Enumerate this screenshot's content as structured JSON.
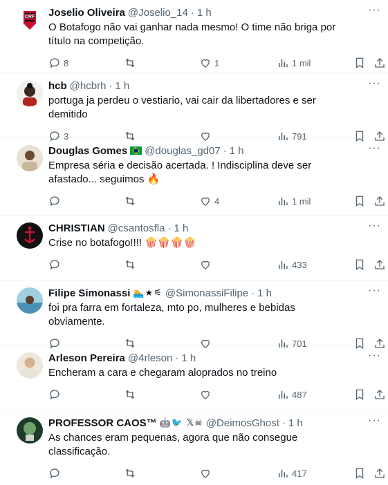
{
  "tweets": [
    {
      "name": "Joselio Oliveira",
      "handle": "@Joselio_14",
      "time": "1 h",
      "extra": "",
      "text": "O Botafogo não vai ganhar nada mesmo! O time não briga por título na competição.",
      "replies": "8",
      "retweets": "",
      "likes": "1",
      "views": "1 mil",
      "avatar_color": "#c8102e"
    },
    {
      "name": "hcb",
      "handle": "@hcbrh",
      "time": "1 h",
      "extra": "",
      "text": "portuga ja perdeu o vestiario, vai cair da libertadores e ser demitido",
      "replies": "3",
      "retweets": "",
      "likes": "",
      "views": "791",
      "avatar_color": "#2b2b2b"
    },
    {
      "name": "Douglas Gomes",
      "handle": "@douglas_gd07",
      "time": "1 h",
      "extra": "flag",
      "text": "Empresa séria e decisão acertada. ! Indisciplina deve ser afastado... seguimos 🔥",
      "replies": "",
      "retweets": "",
      "likes": "4",
      "views": "1 mil",
      "avatar_color": "#c9b79c"
    },
    {
      "name": "CHRISTIAN",
      "handle": "@csantosfla",
      "time": "1 h",
      "extra": "",
      "text": "Crise no botafogo!!!! 🍿🍿🍿🍿",
      "replies": "",
      "retweets": "",
      "likes": "",
      "views": "433",
      "avatar_color": "#111111"
    },
    {
      "name": "Filipe Simonassi",
      "handle": "@SimonassiFilipe",
      "time": "1 h",
      "extra": "🏊★⚟",
      "text": "foi pra farra em fortaleza, mto po, mulheres e bebidas obviamente.",
      "replies": "",
      "retweets": "",
      "likes": "",
      "views": "701",
      "avatar_color": "#7fb3c8"
    },
    {
      "name": "Arleson Pereira",
      "handle": "@4rleson",
      "time": "1 h",
      "extra": "",
      "text": "Encheram a cara e chegaram aloprados no treino",
      "replies": "",
      "retweets": "",
      "likes": "",
      "views": "487",
      "avatar_color": "#d8c2a8"
    },
    {
      "name": "PROFESSOR CAOS™",
      "handle": "@DeimosGhost",
      "time": "1 h",
      "extra": "🤖🐦 𝕏☠",
      "text": "As chances eram pequenas, agora que não consegue classificação.",
      "replies": "",
      "retweets": "",
      "likes": "",
      "views": "417",
      "avatar_color": "#1d3b2a"
    }
  ],
  "icons": {
    "reply": "reply-icon",
    "retweet": "retweet-icon",
    "like": "heart-icon",
    "views": "views-icon",
    "bookmark": "bookmark-icon",
    "share": "share-icon",
    "more": "more-icon"
  }
}
